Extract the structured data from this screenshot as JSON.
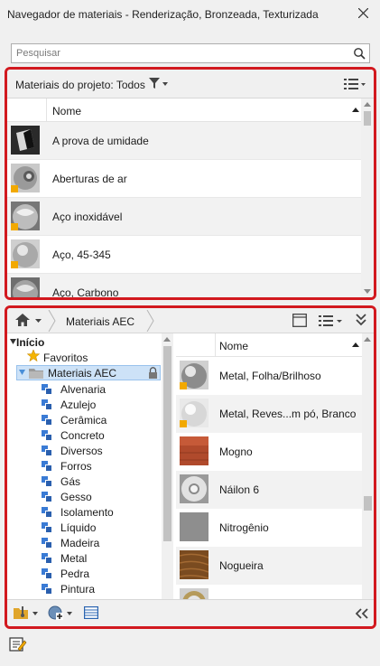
{
  "window": {
    "title": "Navegador de materiais - Renderização, Bronzeada, Texturizada"
  },
  "search": {
    "placeholder": "Pesquisar",
    "value": ""
  },
  "project_panel": {
    "header_label": "Materiais do projeto: Todos",
    "column_name": "Nome",
    "items": [
      {
        "label": "A prova de umidade"
      },
      {
        "label": "Aberturas de ar"
      },
      {
        "label": "Aço inoxidável"
      },
      {
        "label": "Aço, 45-345"
      },
      {
        "label": "Aço, Carbono"
      }
    ]
  },
  "library_panel": {
    "breadcrumb": "Materiais AEC",
    "tree": {
      "root": "Início",
      "favorites": "Favoritos",
      "library": "Materiais AEC",
      "categories": [
        "Alvenaria",
        "Azulejo",
        "Cerâmica",
        "Concreto",
        "Diversos",
        "Forros",
        "Gás",
        "Gesso",
        "Isolamento",
        "Líquido",
        "Madeira",
        "Metal",
        "Pedra",
        "Pintura"
      ]
    },
    "column_name": "Nome",
    "items": [
      {
        "label": "Metal, Folha/Brilhoso"
      },
      {
        "label": "Metal, Reves...m pó, Branco"
      },
      {
        "label": "Mogno"
      },
      {
        "label": "Náilon 6"
      },
      {
        "label": "Nitrogênio"
      },
      {
        "label": "Nogueira"
      }
    ]
  },
  "colors": {
    "highlight_border": "#d2191f",
    "selection": "#cde2f7",
    "library_blue": "#3a7bd5",
    "badge": "#f2a900"
  }
}
